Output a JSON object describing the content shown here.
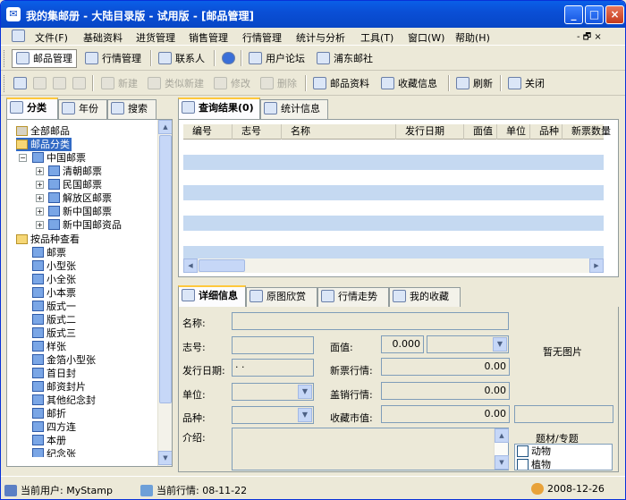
{
  "window": {
    "title": "我的集邮册 - 大陆目录版 - 试用版 - [邮品管理]",
    "controls": {
      "minimize": "_",
      "maximize": "□",
      "close": "×"
    }
  },
  "menu": {
    "items": [
      "文件(F)",
      "基础资料",
      "进货管理",
      "销售管理",
      "行情管理",
      "统计与分析",
      "工具(T)",
      "窗口(W)",
      "帮助(H)"
    ],
    "mdi_controls": "- 🗗 ×"
  },
  "toolbar1": {
    "buttons": [
      "邮品管理",
      "行情管理",
      "联系人",
      "用户论坛",
      "浦东邮社"
    ]
  },
  "toolbar2": {
    "buttons": [
      "新建",
      "类似新建",
      "修改",
      "删除",
      "邮品资料",
      "收藏信息",
      "刷新",
      "关闭"
    ]
  },
  "left_tabs": [
    "分类",
    "年份",
    "搜索"
  ],
  "tree": {
    "all": "全部邮品",
    "category_root": "邮品分类",
    "china": "中国邮票",
    "china_children": [
      "清朝邮票",
      "民国邮票",
      "解放区邮票",
      "新中国邮票",
      "新中国邮资品"
    ],
    "by_kind": "按品种查看",
    "kinds": [
      "邮票",
      "小型张",
      "小全张",
      "小本票",
      "版式一",
      "版式二",
      "版式三",
      "样张",
      "金箔小型张",
      "首日封",
      "邮资封片",
      "其他纪念封",
      "邮折",
      "四方连",
      "本册",
      "纪念张"
    ]
  },
  "result_tabs": [
    "查询结果(0)",
    "统计信息"
  ],
  "grid": {
    "columns": [
      "编号",
      "志号",
      "名称",
      "发行日期",
      "面值",
      "单位",
      "品种",
      "新票数量"
    ]
  },
  "detail_tabs": [
    "详细信息",
    "原图欣赏",
    "行情走势",
    "我的收藏"
  ],
  "detail": {
    "name_label": "名称:",
    "zhihao_label": "志号:",
    "mianzhi_label": "面值:",
    "mianzhi_value": "0.000",
    "date_label": "发行日期:",
    "date_value": "· ·",
    "xinpiao_label": "新票行情:",
    "xinpiao_value": "0.00",
    "unit_label": "单位:",
    "gaixiao_label": "盖销行情:",
    "gaixiao_value": "0.00",
    "kind_label": "品种:",
    "collect_label": "收藏市值:",
    "collect_value": "0.00",
    "intro_label": "介绍:",
    "no_image": "暂无图片",
    "theme_label": "题材/专题",
    "themes": [
      "动物",
      "植物"
    ]
  },
  "status": {
    "user": "当前用户: MyStamp",
    "market": "当前行情: 08-11-22",
    "date": "2008-12-26"
  }
}
